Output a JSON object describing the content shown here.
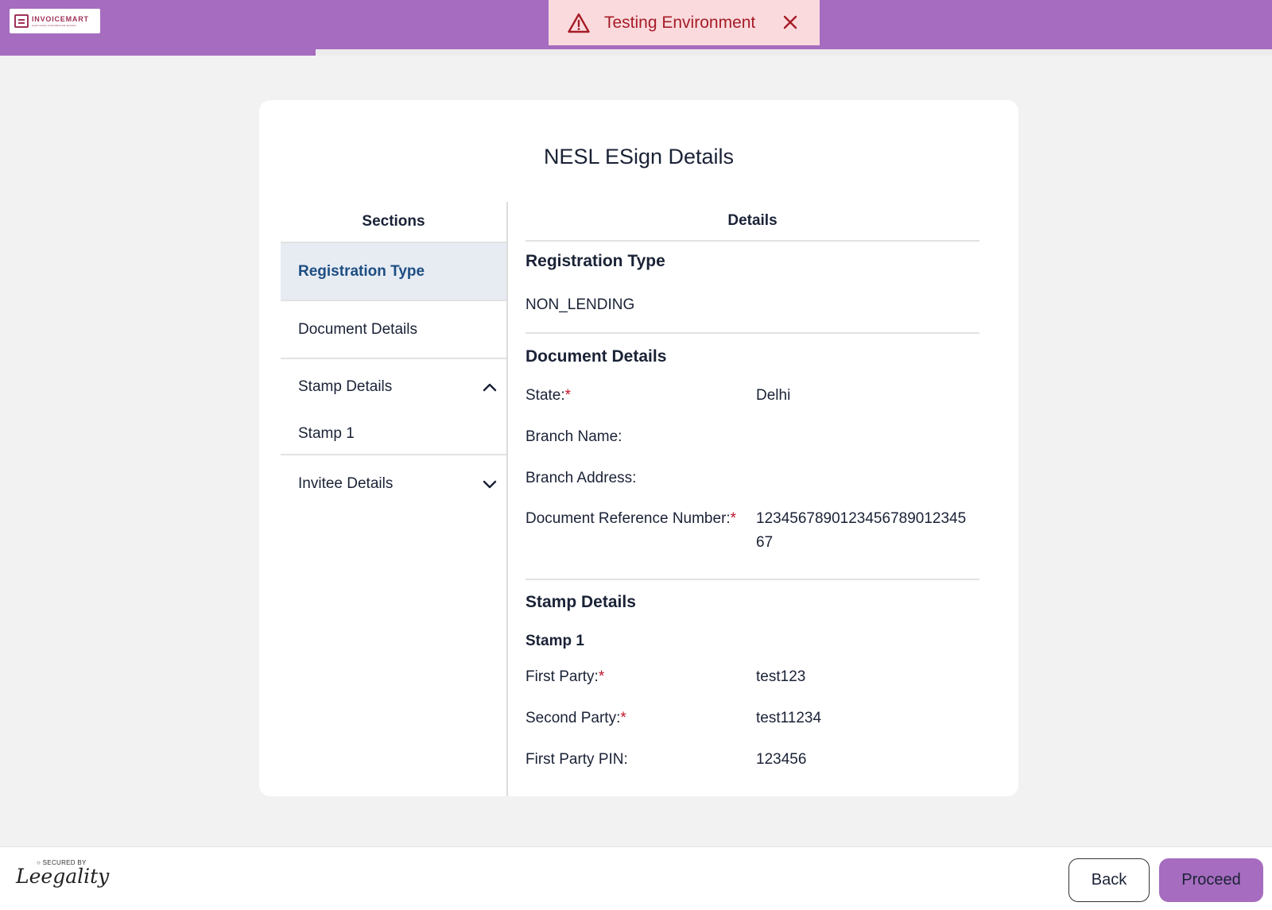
{
  "app": {
    "logo_text": "INVOICEMART",
    "logo_tagline": "A joint venture of Axis Bank and mjunction",
    "progress_percent": 24.8
  },
  "env_banner": {
    "text": "Testing Environment",
    "icon": "warning-triangle-icon",
    "close_icon": "close-icon"
  },
  "card": {
    "title": "NESL ESign Details",
    "sections_header": "Sections",
    "details_header": "Details",
    "sections": {
      "registration_type": "Registration Type",
      "document_details": "Document Details",
      "stamp_details": "Stamp Details",
      "stamp_1": "Stamp 1",
      "invitee_details": "Invitee Details"
    },
    "details": {
      "registration": {
        "title": "Registration Type",
        "value": "NON_LENDING"
      },
      "document": {
        "title": "Document Details",
        "state_label": "State:",
        "state_value": "Delhi",
        "branch_name_label": "Branch Name:",
        "branch_name_value": "",
        "branch_address_label": "Branch Address:",
        "branch_address_value": "",
        "ref_label": "Document Reference Number:",
        "ref_value": "1234567890123456789012345 67"
      },
      "stamp": {
        "title": "Stamp Details",
        "stamp_title": "Stamp 1",
        "first_party_label": "First Party:",
        "first_party_value": "test123",
        "second_party_label": "Second Party:",
        "second_party_value": "test11234",
        "first_party_pin_label": "First Party PIN:",
        "first_party_pin_value": "123456"
      },
      "required_marker": "*"
    }
  },
  "footer": {
    "secured_label": "SECURED BY",
    "secured_brand": "Leegality",
    "back_label": "Back",
    "proceed_label": "Proceed"
  },
  "colors": {
    "brand_purple": "#a66cbf",
    "banner_bg": "#fadadd",
    "banner_text": "#a51c27",
    "active_section_bg": "#e7ecf3",
    "active_section_text": "#1d4e82",
    "required": "#c0142a"
  }
}
